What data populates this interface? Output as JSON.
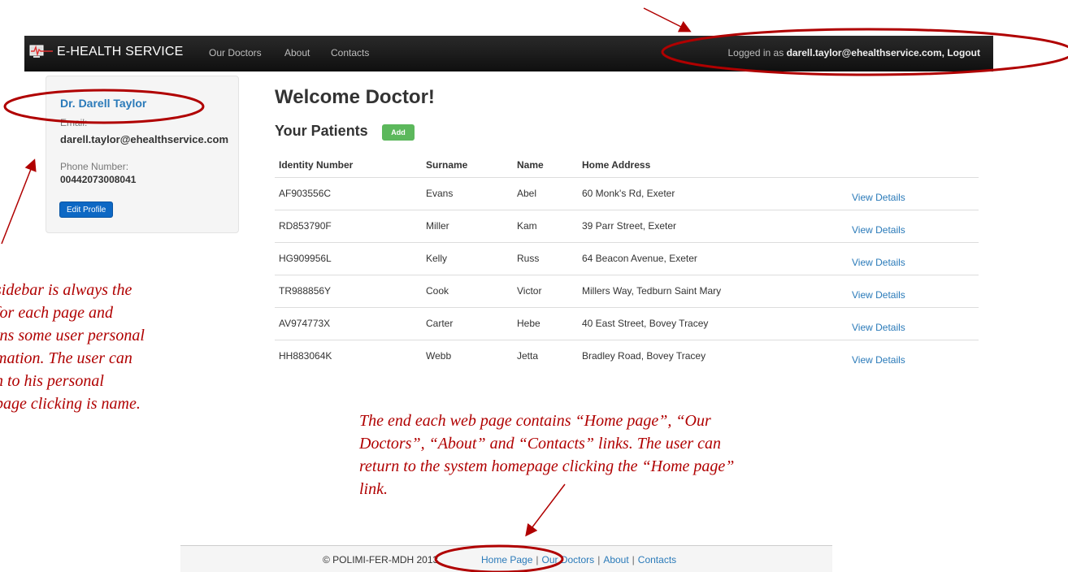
{
  "navbar": {
    "brand": "E-HEALTH SERVICE",
    "links": [
      "Our Doctors",
      "About",
      "Contacts"
    ],
    "login_prefix": "Logged in as",
    "login_user": "darell.taylor@ehealthservice.com, Logout"
  },
  "sidebar": {
    "doctor_name": "Dr. Darell Taylor",
    "email_label": "Email:",
    "email_value": "darell.taylor@ehealthservice.com",
    "phone_label": "Phone Number:",
    "phone_value": "00442073008041",
    "edit_button": "Edit Profile"
  },
  "main": {
    "welcome": "Welcome Doctor!",
    "patients_title": "Your Patients",
    "add_button": "Add",
    "table": {
      "headers": [
        "Identity Number",
        "Surname",
        "Name",
        "Home Address"
      ],
      "rows": [
        {
          "id": "AF903556C",
          "surname": "Evans",
          "name": "Abel",
          "address": "60 Monk's Rd, Exeter",
          "action": "View Details"
        },
        {
          "id": "RD853790F",
          "surname": "Miller",
          "name": "Kam",
          "address": "39 Parr Street, Exeter",
          "action": "View Details"
        },
        {
          "id": "HG909956L",
          "surname": "Kelly",
          "name": "Russ",
          "address": "64 Beacon Avenue, Exeter",
          "action": "View Details"
        },
        {
          "id": "TR988856Y",
          "surname": "Cook",
          "name": "Victor",
          "address": "Millers Way, Tedburn Saint Mary",
          "action": "View Details"
        },
        {
          "id": "AV974773X",
          "surname": "Carter",
          "name": "Hebe",
          "address": "40 East Street, Bovey Tracey",
          "action": "View Details"
        },
        {
          "id": "HH883064K",
          "surname": "Webb",
          "name": "Jetta",
          "address": "Bradley Road, Bovey Tracey",
          "action": "View Details"
        }
      ]
    }
  },
  "annotations": {
    "left_lines": [
      "sidebar is always the",
      "for each page and",
      "ins some user personal",
      "mation. The user can",
      "n to his personal",
      "page clicking is name."
    ],
    "bottom_lines": [
      "The end each web page contains “Home page”, “Our",
      "Doctors”, “About” and “Contacts” links. The user can",
      "return to the system homepage clicking the “Home page”",
      "link."
    ]
  },
  "footer": {
    "copyright": "© POLIMI-FER-MDH 2013",
    "links": [
      "Home Page",
      "Our Doctors",
      "About",
      "Contacts"
    ],
    "separator": "|"
  },
  "colors": {
    "annotation": "#b00000",
    "link": "#2a7ab9",
    "primary_button": "#0d68c4",
    "success_button": "#5cb85c",
    "navbar": "#1a1a1a"
  }
}
